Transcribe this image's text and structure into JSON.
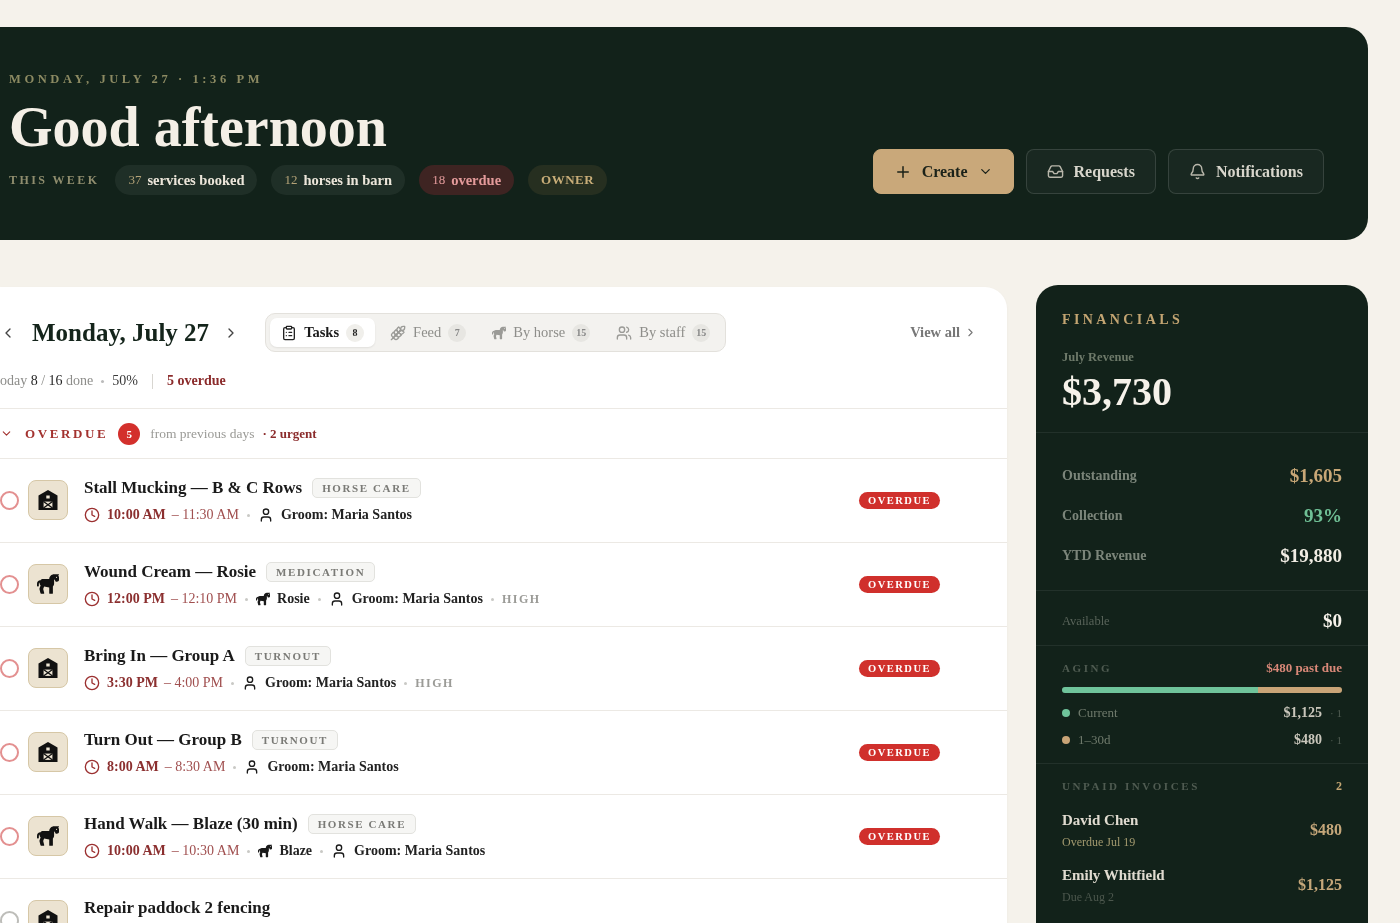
{
  "header": {
    "datetime": "MONDAY, JULY 27 · 1:36 PM",
    "greeting": "Good afternoon",
    "week_label": "THIS WEEK",
    "chips": [
      {
        "kind": "stat",
        "count": "37",
        "label": "services booked"
      },
      {
        "kind": "stat",
        "count": "12",
        "label": "horses in barn"
      },
      {
        "kind": "alert",
        "count": "18",
        "label": "overdue"
      },
      {
        "kind": "role",
        "label": "OWNER"
      }
    ],
    "actions": [
      {
        "kind": "primary",
        "label": "Create",
        "menu": true
      },
      {
        "kind": "secondary",
        "label": "Requests",
        "menu": false
      },
      {
        "kind": "secondary",
        "label": "Notifications",
        "menu": false
      }
    ]
  },
  "schedule": {
    "date": "Monday, July 27",
    "tabs": [
      {
        "label": "Tasks",
        "count": "8",
        "selected": true
      },
      {
        "label": "Feed",
        "count": "7",
        "selected": false
      },
      {
        "label": "By horse",
        "count": "15",
        "selected": false
      },
      {
        "label": "By staff",
        "count": "15",
        "selected": false
      }
    ],
    "view_all": "View all",
    "progress": "oday **8** / **16** done",
    "percent": "50%",
    "overdue_total": "5 overdue",
    "section": {
      "title": "OVERDUE",
      "expanded": true,
      "count": "5",
      "note": "from previous days",
      "urgent": "· 2 urgent"
    },
    "tasks": [
      {
        "kind": "barn",
        "title": "Stall Mucking — B & C Rows",
        "tag": "HORSE CARE",
        "start": "10:00 AM",
        "end": "– 11:30 AM",
        "assignee": "Groom: Maria Santos",
        "status": "OVERDUE",
        "overdue": true,
        "checked": false
      },
      {
        "kind": "horse",
        "title": "Wound Cream — Rosie",
        "tag": "MEDICATION",
        "start": "12:00 PM",
        "end": "– 12:10 PM",
        "horse": "Rosie",
        "assignee": "Groom: Maria Santos",
        "priority": "HIGH",
        "status": "OVERDUE",
        "overdue": true,
        "checked": false
      },
      {
        "kind": "barn",
        "title": "Bring In — Group A",
        "tag": "TURNOUT",
        "start": "3:30 PM",
        "end": "– 4:00 PM",
        "assignee": "Groom: Maria Santos",
        "priority": "HIGH",
        "status": "OVERDUE",
        "overdue": true,
        "checked": false
      },
      {
        "kind": "barn",
        "title": "Turn Out — Group B",
        "tag": "TURNOUT",
        "start": "8:00 AM",
        "end": "– 8:30 AM",
        "assignee": "Groom: Maria Santos",
        "status": "OVERDUE",
        "overdue": true,
        "checked": false
      },
      {
        "kind": "horse",
        "title": "Hand Walk — Blaze (30 min)",
        "tag": "HORSE CARE",
        "start": "10:00 AM",
        "end": "– 10:30 AM",
        "horse": "Blaze",
        "assignee": "Groom: Maria Santos",
        "status": "OVERDUE",
        "overdue": true,
        "checked": false
      },
      {
        "kind": "barn",
        "title": "Repair paddock 2 fencing",
        "overdue": false,
        "checked": false
      }
    ]
  },
  "financials": {
    "title": "FINANCIALS",
    "revenue_label": "July Revenue",
    "revenue": "$3,730",
    "metrics": [
      {
        "label": "Outstanding",
        "value": "$1,605",
        "color": "#c9a877"
      },
      {
        "label": "Collection",
        "value": "93%",
        "color": "#6fbf95"
      },
      {
        "label": "YTD Revenue",
        "value": "$19,880",
        "color": "#f1ede4"
      }
    ],
    "balance": {
      "label": "Available",
      "value": "$0"
    },
    "aging": {
      "title": "AGING",
      "summary": "$480 past due",
      "buckets": [
        {
          "label": "Current",
          "amount": "$1,125",
          "count": "· 1",
          "color": "#6fc49b",
          "level": 0.7
        },
        {
          "label": "1–30d",
          "amount": "$480",
          "count": "· 1",
          "color": "#c9a477",
          "level": 0.3
        }
      ]
    },
    "invoices": {
      "title": "UNPAID INVOICES",
      "count": "2",
      "items": [
        {
          "name": "David Chen",
          "note": "Overdue Jul 19",
          "amount": "$480",
          "overdue": true
        },
        {
          "name": "Emily Whitfield",
          "note": "Due Aug 2",
          "amount": "$1,125",
          "overdue": false
        }
      ]
    }
  }
}
